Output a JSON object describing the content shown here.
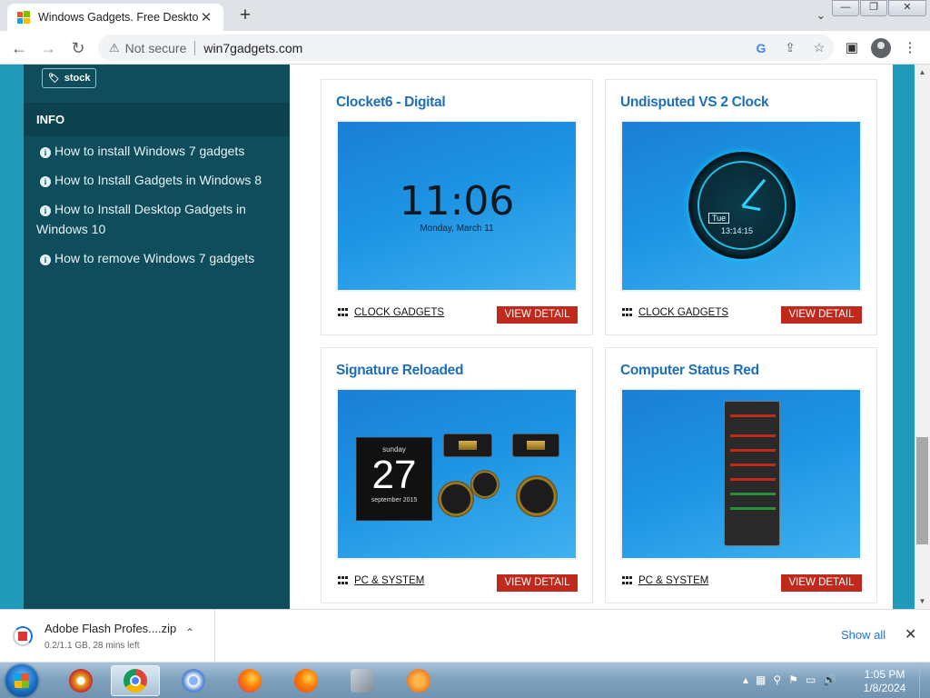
{
  "browser": {
    "tab_title": "Windows Gadgets. Free Desktop",
    "tab_close": "✕",
    "new_tab": "+",
    "tab_search": "⌄",
    "window_buttons": [
      "—",
      "❐",
      "✕"
    ],
    "nav": {
      "back": "←",
      "forward": "→",
      "reload": "↻"
    },
    "security_label": "Not secure",
    "security_icon": "⚠",
    "url": "win7gadgets.com",
    "omnibox_icons": [
      "G",
      "⇪",
      "☆"
    ],
    "toolbar_icons": {
      "sidebar": "▣",
      "menu": "⋮"
    }
  },
  "sidebar": {
    "tag": {
      "icon": "tag-icon",
      "label": "stock"
    },
    "info_heading": "INFO",
    "info_items": [
      "How to install Windows 7 gadgets",
      "How to Install Gadgets in Windows 8",
      "How to Install Desktop Gadgets in Windows 10",
      "How to remove Windows 7 gadgets"
    ]
  },
  "cards": [
    {
      "title": "Clocket6 - Digital",
      "category": "CLOCK GADGETS",
      "button": "VIEW DETAIL",
      "preview": {
        "time": "11:06",
        "date": "Monday, March 11"
      }
    },
    {
      "title": "Undisputed VS 2 Clock",
      "category": "CLOCK GADGETS",
      "button": "VIEW DETAIL",
      "preview": {
        "day": "Tue",
        "time": "13:14:15"
      }
    },
    {
      "title": "Signature Reloaded",
      "category": "PC & SYSTEM",
      "button": "VIEW DETAIL",
      "preview": {
        "weekday": "sunday",
        "day": "27",
        "month": "september 2015"
      }
    },
    {
      "title": "Computer Status Red",
      "category": "PC & SYSTEM",
      "button": "VIEW DETAIL"
    }
  ],
  "download": {
    "filename": "Adobe Flash Profes....zip",
    "status": "0.2/1.1 GB, 28 mins left",
    "caret": "⌃",
    "show_all": "Show all",
    "close": "✕"
  },
  "taskbar": {
    "apps": [
      "security-app",
      "chrome",
      "chromium",
      "firefox-dev",
      "firefox",
      "tools-app",
      "audio-app"
    ],
    "tray_icons": [
      "▴",
      "▦",
      "⚲",
      "⚑",
      "▭",
      "🔊"
    ],
    "time": "1:05 PM",
    "date": "1/8/2024"
  },
  "colors": {
    "page_bg": "#1f9ab8",
    "sidebar_bg": "#0f4d5c",
    "title_link": "#1c6fb8",
    "button_red": "#c0291c"
  }
}
